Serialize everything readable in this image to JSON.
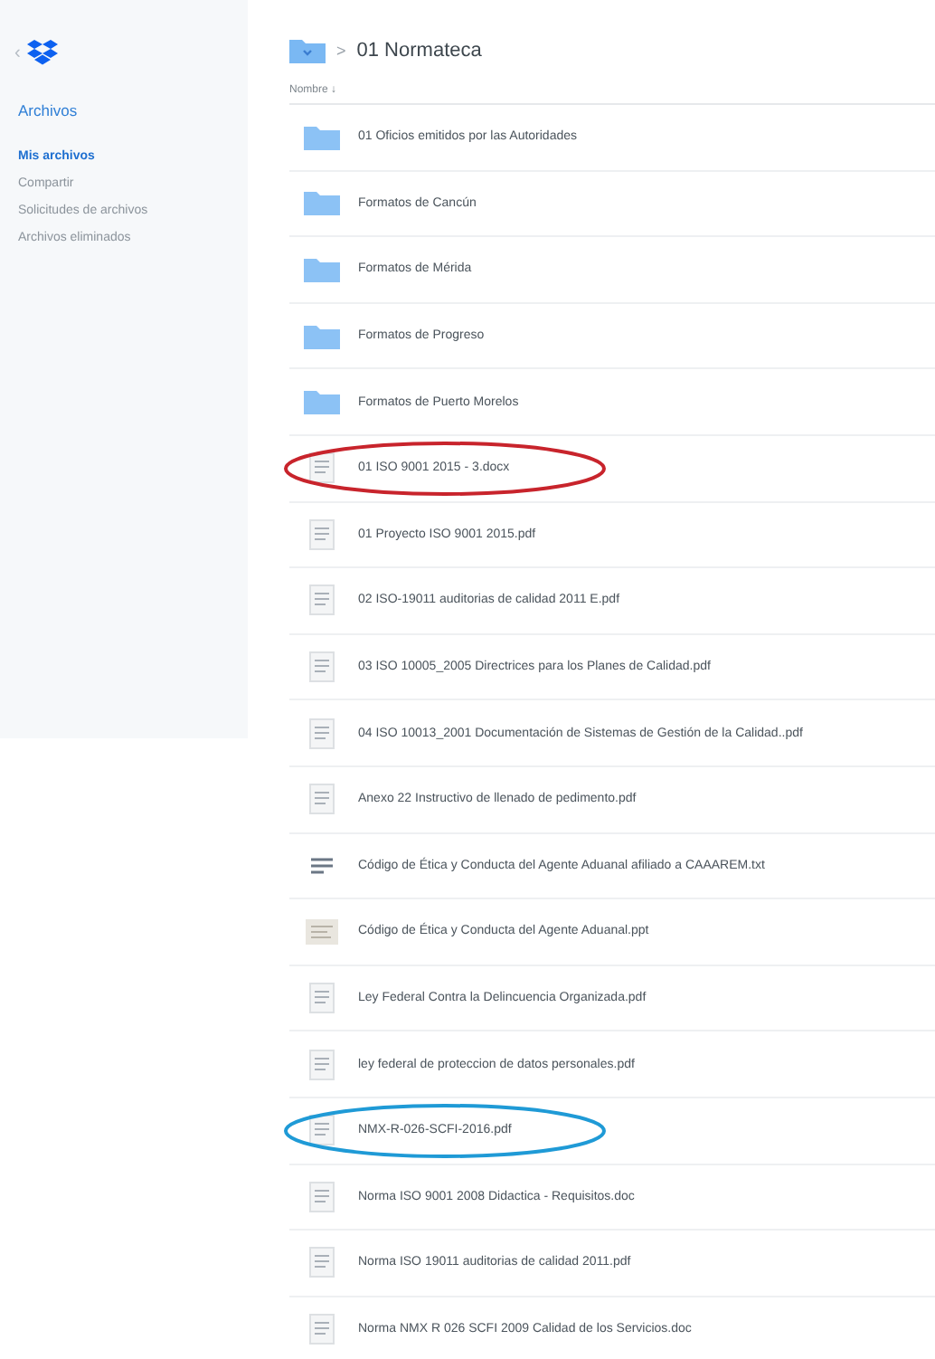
{
  "sidebar": {
    "back": "‹",
    "title": "Archivos",
    "items": [
      {
        "label": "Mis archivos",
        "selected": true
      },
      {
        "label": "Compartir",
        "selected": false
      },
      {
        "label": "Solicitudes de archivos",
        "selected": false
      },
      {
        "label": "Archivos eliminados",
        "selected": false
      }
    ]
  },
  "breadcrumb": {
    "separator": ">",
    "folder": "01 Normateca"
  },
  "list": {
    "column": "Nombre ↓",
    "rows": [
      {
        "kind": "folder",
        "name": "01 Oficios emitidos por las Autoridades"
      },
      {
        "kind": "folder",
        "name": "Formatos de Cancún"
      },
      {
        "kind": "folder",
        "name": "Formatos de Mérida"
      },
      {
        "kind": "folder",
        "name": "Formatos de Progreso"
      },
      {
        "kind": "folder",
        "name": "Formatos de Puerto Morelos"
      },
      {
        "kind": "doc",
        "name": "01 ISO 9001 2015 - 3.docx",
        "color": "#c8242c"
      },
      {
        "kind": "doc",
        "name": "01 Proyecto ISO 9001 2015.pdf"
      },
      {
        "kind": "doc",
        "name": "02 ISO-19011 auditorias de calidad 2011 E.pdf"
      },
      {
        "kind": "doc",
        "name": "03 ISO 10005_2005 Directrices para los Planes de Calidad.pdf"
      },
      {
        "kind": "doc",
        "name": "04 ISO 10013_2001 Documentación de Sistemas de Gestión de la Calidad..pdf"
      },
      {
        "kind": "doc",
        "name": "Anexo 22 Instructivo de llenado de pedimento.pdf"
      },
      {
        "kind": "text",
        "name": "Código de Ética y Conducta del Agente Aduanal afiliado a CAAAREM.txt"
      },
      {
        "kind": "slides",
        "name": "Código de Ética y Conducta del Agente Aduanal.ppt"
      },
      {
        "kind": "doc",
        "name": "Ley Federal Contra la Delincuencia Organizada.pdf"
      },
      {
        "kind": "doc",
        "name": "ley federal de proteccion de datos personales.pdf"
      },
      {
        "kind": "doc",
        "name": "NMX-R-026-SCFI-2016.pdf",
        "color": "#1f9ad6"
      },
      {
        "kind": "doc",
        "name": "Norma ISO 9001 2008 Didactica - Requisitos.doc"
      },
      {
        "kind": "doc",
        "name": "Norma ISO 19011 auditorias de calidad 2011.pdf"
      },
      {
        "kind": "doc",
        "name": "Norma NMX R 026 SCFI 2009 Calidad de los Servicios.doc"
      }
    ]
  }
}
